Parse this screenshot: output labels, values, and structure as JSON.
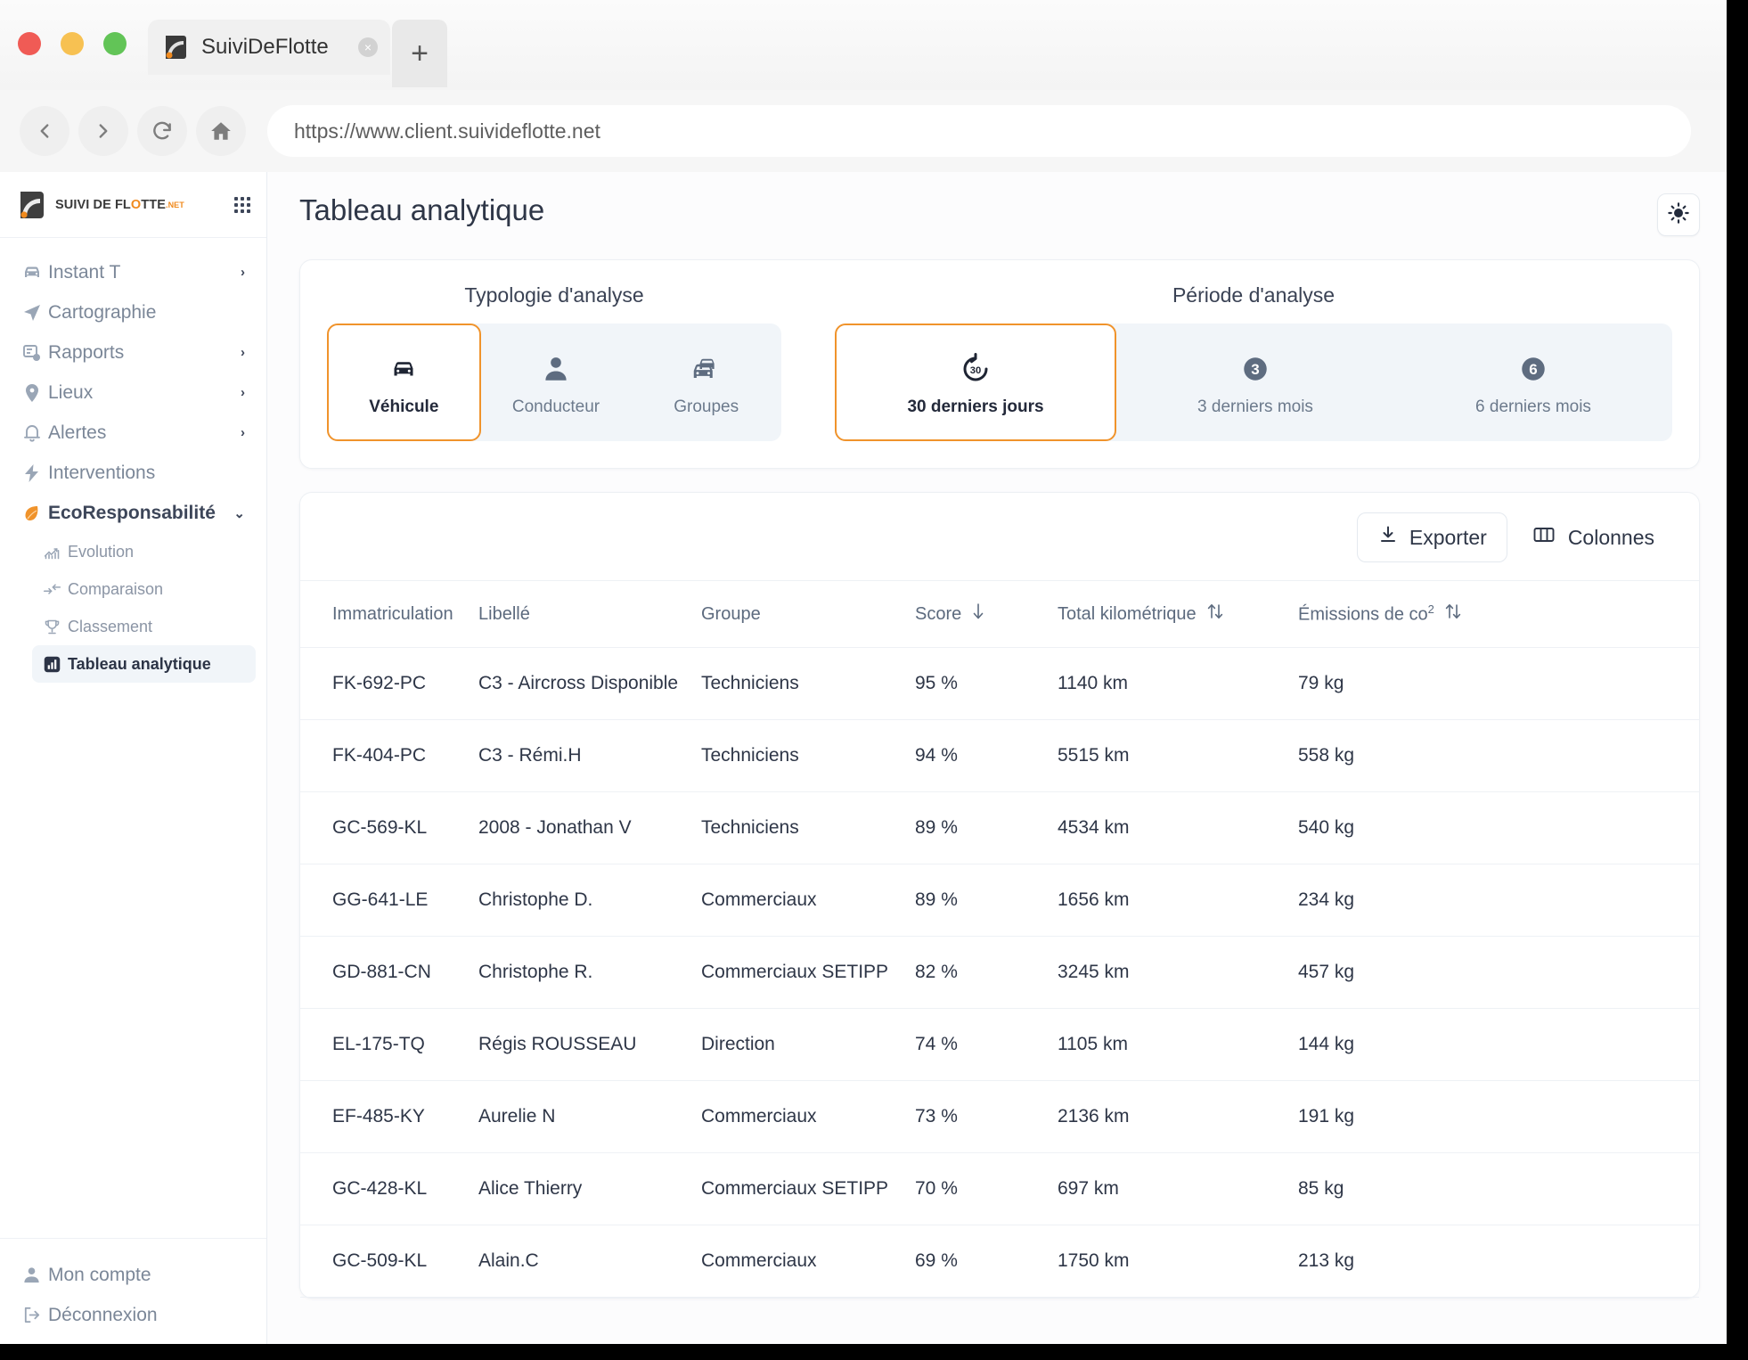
{
  "browser": {
    "tab_title": "SuiviDeFlotte",
    "tab_close_label": "×",
    "new_tab_label": "+",
    "url": "https://www.client.suivideflotte.net",
    "nav": {
      "back": "back-icon",
      "forward": "forward-icon",
      "reload": "reload-icon",
      "home": "home-icon"
    }
  },
  "sidebar": {
    "logo": {
      "part1": "SUIVI DE FL",
      "highlight": "O",
      "part2": "TTE",
      "suffix": ".NET"
    },
    "items": [
      {
        "label": "Instant T",
        "icon": "car-icon",
        "chevron": "›"
      },
      {
        "label": "Cartographie",
        "icon": "navigation-icon",
        "chevron": ""
      },
      {
        "label": "Rapports",
        "icon": "report-icon",
        "chevron": "›"
      },
      {
        "label": "Lieux",
        "icon": "pin-icon",
        "chevron": "›"
      },
      {
        "label": "Alertes",
        "icon": "bell-icon",
        "chevron": "›"
      },
      {
        "label": "Interventions",
        "icon": "bolt-icon",
        "chevron": ""
      },
      {
        "label": "EcoResponsabilité",
        "icon": "leaf-icon",
        "chevron": "⌄"
      }
    ],
    "subitems": [
      {
        "label": "Evolution",
        "icon": "chart-line-icon",
        "active": false
      },
      {
        "label": "Comparaison",
        "icon": "compare-arrows-icon",
        "active": false
      },
      {
        "label": "Classement",
        "icon": "trophy-icon",
        "active": false
      },
      {
        "label": "Tableau analytique",
        "icon": "bar-chart-icon",
        "active": true
      }
    ],
    "footer": [
      {
        "label": "Mon compte",
        "icon": "user-icon"
      },
      {
        "label": "Déconnexion",
        "icon": "logout-icon"
      }
    ]
  },
  "main": {
    "page_title": "Tableau analytique",
    "theme_toggle_icon": "sun-icon",
    "filters": {
      "typology": {
        "title": "Typologie d'analyse",
        "options": [
          {
            "label": "Véhicule",
            "icon": "car-front-icon",
            "selected": true
          },
          {
            "label": "Conducteur",
            "icon": "person-icon",
            "selected": false
          },
          {
            "label": "Groupes",
            "icon": "cars-group-icon",
            "selected": false
          }
        ]
      },
      "period": {
        "title": "Période d'analyse",
        "options": [
          {
            "label": "30 derniers jours",
            "icon": "rotate-30-icon",
            "badge": "30",
            "selected": true
          },
          {
            "label": "3 derniers mois",
            "icon": "badge-3-icon",
            "badge": "3",
            "selected": false
          },
          {
            "label": "6 derniers mois",
            "icon": "badge-6-icon",
            "badge": "6",
            "selected": false
          }
        ]
      }
    },
    "table": {
      "export_label": "Exporter",
      "columns_label": "Colonnes",
      "export_icon": "download-icon",
      "columns_icon": "columns-icon",
      "headers": [
        {
          "label": "Immatriculation",
          "sort": ""
        },
        {
          "label": "Libellé",
          "sort": ""
        },
        {
          "label": "Groupe",
          "sort": ""
        },
        {
          "label": "Score",
          "sort": "desc"
        },
        {
          "label": "Total kilométrique",
          "sort": "both"
        },
        {
          "label": "Émissions de co",
          "sup": "2",
          "sort": "both"
        }
      ],
      "rows": [
        {
          "immat": "FK-692-PC",
          "libelle": "C3 - Aircross Disponible",
          "groupe": "Techniciens",
          "score": "95 %",
          "km": "1140 km",
          "co2": "79 kg"
        },
        {
          "immat": "FK-404-PC",
          "libelle": "C3 - Rémi.H",
          "groupe": "Techniciens",
          "score": "94 %",
          "km": "5515 km",
          "co2": "558 kg"
        },
        {
          "immat": "GC-569-KL",
          "libelle": "2008 - Jonathan V",
          "groupe": "Techniciens",
          "score": "89 %",
          "km": "4534 km",
          "co2": "540 kg"
        },
        {
          "immat": "GG-641-LE",
          "libelle": "Christophe D.",
          "groupe": "Commerciaux",
          "score": "89 %",
          "km": "1656 km",
          "co2": "234 kg"
        },
        {
          "immat": "GD-881-CN",
          "libelle": "Christophe R.",
          "groupe": "Commerciaux SETIPP",
          "score": "82 %",
          "km": "3245 km",
          "co2": "457 kg"
        },
        {
          "immat": "EL-175-TQ",
          "libelle": "Régis ROUSSEAU",
          "groupe": "Direction",
          "score": "74 %",
          "km": "1105 km",
          "co2": "144 kg"
        },
        {
          "immat": "EF-485-KY",
          "libelle": "Aurelie N",
          "groupe": "Commerciaux",
          "score": "73 %",
          "km": "2136 km",
          "co2": "191 kg"
        },
        {
          "immat": "GC-428-KL",
          "libelle": "Alice Thierry",
          "groupe": "Commerciaux SETIPP",
          "score": "70 %",
          "km": "697 km",
          "co2": "85 kg"
        },
        {
          "immat": "GC-509-KL",
          "libelle": "Alain.C",
          "groupe": "Commerciaux",
          "score": "69 %",
          "km": "1750 km",
          "co2": "213 kg"
        }
      ]
    }
  },
  "colors": {
    "accent_orange": "#f0932b",
    "text_dark": "#2e3647",
    "text_muted": "#7b8798",
    "panel_bg": "#ffffff",
    "seg_bg": "#f1f5f9"
  }
}
